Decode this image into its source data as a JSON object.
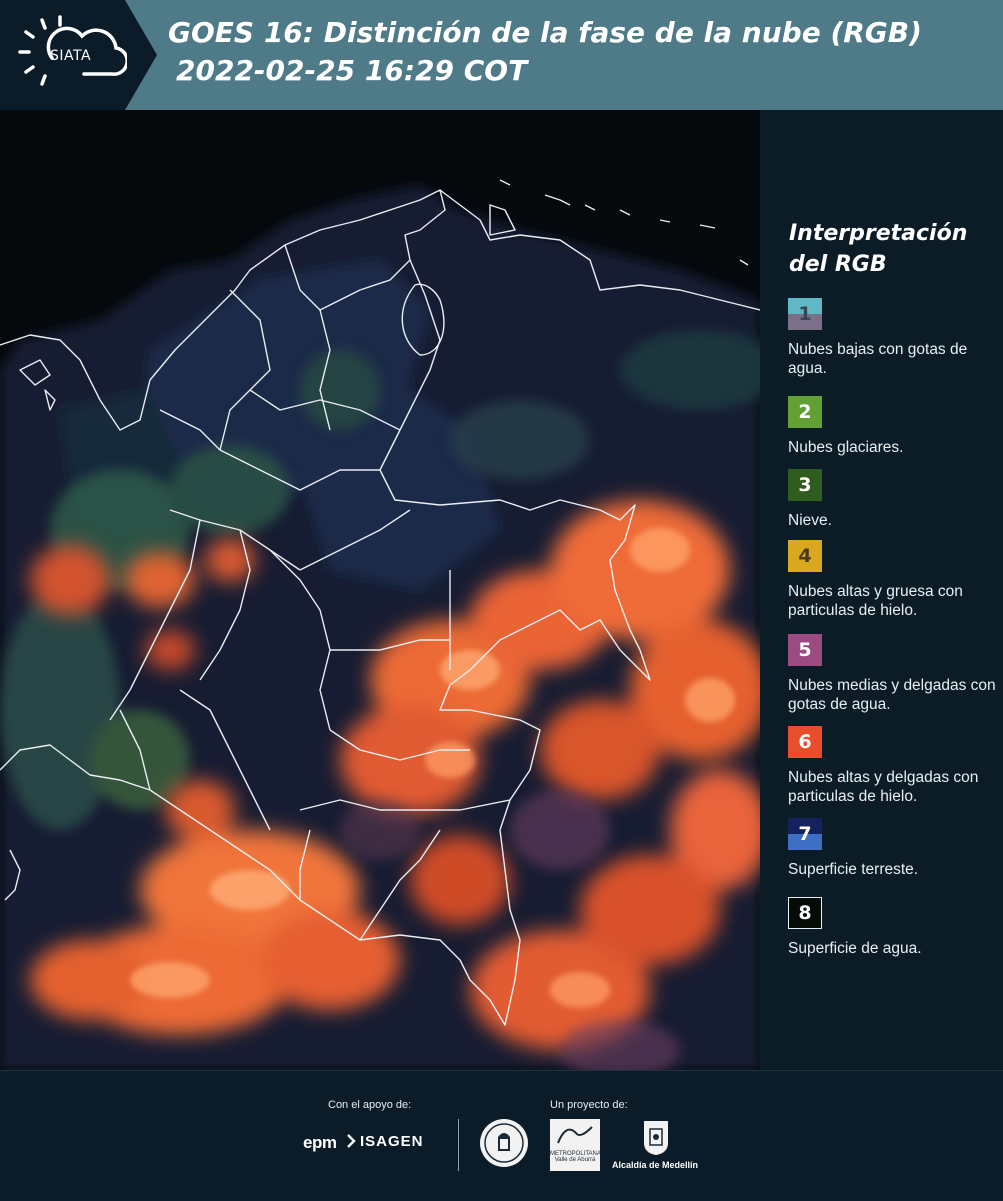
{
  "header": {
    "logo_text": "SIATA",
    "title_line1": "GOES 16: Distinción de la fase de la nube (RGB)",
    "title_line2": "2022-02-25 16:29 COT"
  },
  "legend": {
    "title": "Interpretación del RGB",
    "items": [
      {
        "number": "1",
        "label": "Nubes bajas con gotas de agua.",
        "color_top": "#5fb8c4",
        "color_bottom": "#7b6f8a"
      },
      {
        "number": "2",
        "label": "Nubes glaciares.",
        "color_top": "#62a033",
        "color_bottom": "#62a033"
      },
      {
        "number": "3",
        "label": "Nieve.",
        "color_top": "#2e5d1f",
        "color_bottom": "#2e5d1f"
      },
      {
        "number": "4",
        "label": "Nubes altas y gruesa con particulas de hielo.",
        "color_top": "#d9a820",
        "color_bottom": "#d9a820"
      },
      {
        "number": "5",
        "label": "Nubes medias y delgadas con gotas de agua.",
        "color_top": "#9c4a82",
        "color_bottom": "#9c4a82"
      },
      {
        "number": "6",
        "label": "Nubes altas y delgadas con particulas de hielo.",
        "color_top": "#e84e2c",
        "color_bottom": "#e84e2c"
      },
      {
        "number": "7",
        "label": "Superficie terreste.",
        "color_top": "#14235e",
        "color_bottom": "#3e6fc4"
      },
      {
        "number": "8",
        "label": "Superficie de agua.",
        "color_top": "#050b06",
        "color_bottom": "#050b06"
      }
    ]
  },
  "footer": {
    "support_label": "Con el apoyo de:",
    "project_label": "Un proyecto de:",
    "epm": "epm",
    "isagen": "ISAGEN",
    "area_text": "METROPOLITANA Valle de Aburrá",
    "alcaldia": "Alcaldía de Medellín"
  },
  "colors": {
    "header_bg": "#4f7a88",
    "panel_bg": "#0c1c27",
    "cloud_ice": "#e8542c"
  }
}
